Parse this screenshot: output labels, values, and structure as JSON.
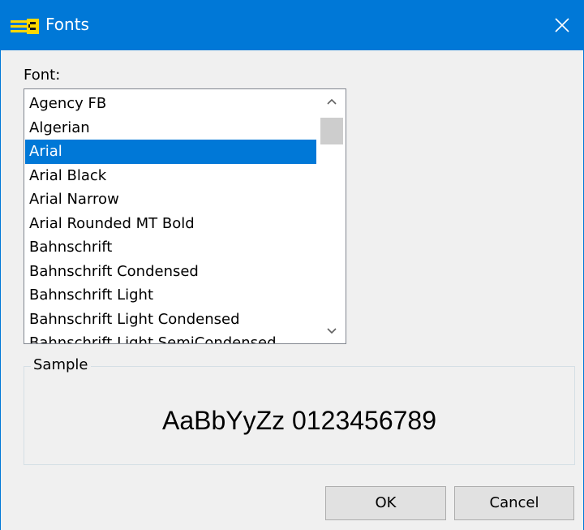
{
  "window": {
    "title": "Fonts",
    "accent_color": "#0078d7",
    "icons": {
      "app": "fonts-app-icon",
      "close": "close-icon"
    }
  },
  "font_list": {
    "label": "Font:",
    "selected": "Arial",
    "items": [
      "Agency FB",
      "Algerian",
      "Arial",
      "Arial Black",
      "Arial Narrow",
      "Arial Rounded MT Bold",
      "Bahnschrift",
      "Bahnschrift Condensed",
      "Bahnschrift Light",
      "Bahnschrift Light Condensed",
      "Bahnschrift Light SemiCondensed"
    ],
    "scrollbar_icons": {
      "up": "chevron-up-icon",
      "down": "chevron-down-icon"
    }
  },
  "sample": {
    "label": "Sample",
    "text": "AaBbYyZz 0123456789"
  },
  "buttons": {
    "ok": "OK",
    "cancel": "Cancel"
  }
}
